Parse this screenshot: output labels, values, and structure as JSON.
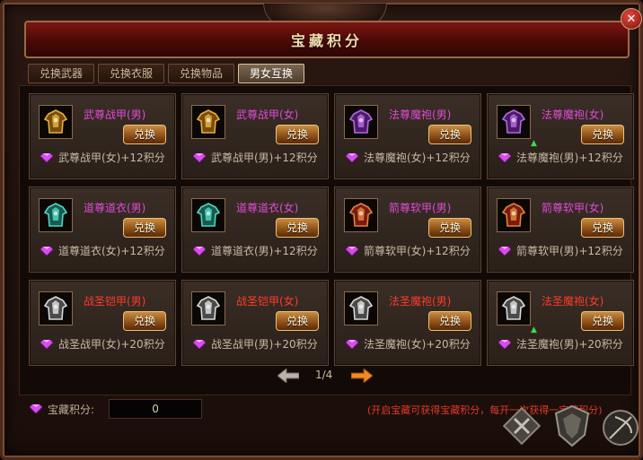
{
  "window": {
    "title": "宝藏积分",
    "close": "✕"
  },
  "tabs": [
    {
      "label": "兑换武器",
      "active": false
    },
    {
      "label": "兑换衣服",
      "active": false
    },
    {
      "label": "兑换物品",
      "active": false
    },
    {
      "label": "男女互换",
      "active": true
    }
  ],
  "cards": [
    {
      "name": "武尊战甲(男)",
      "cost": "武尊战甲(女)+12积分",
      "button": "兑换",
      "icon": "gold-armor-icon"
    },
    {
      "name": "武尊战甲(女)",
      "cost": "武尊战甲(男)+12积分",
      "button": "兑换",
      "icon": "gold-armor-icon"
    },
    {
      "name": "法尊魔袍(男)",
      "cost": "法尊魔袍(女)+12积分",
      "button": "兑换",
      "icon": "purple-robe-icon"
    },
    {
      "name": "法尊魔袍(女)",
      "cost": "法尊魔袍(男)+12积分",
      "button": "兑换",
      "icon": "purple-robe-icon"
    },
    {
      "name": "道尊道衣(男)",
      "cost": "道尊道衣(女)+12积分",
      "button": "兑换",
      "icon": "cyan-robe-icon"
    },
    {
      "name": "道尊道衣(女)",
      "cost": "道尊道衣(男)+12积分",
      "button": "兑换",
      "icon": "cyan-robe-icon"
    },
    {
      "name": "箭尊软甲(男)",
      "cost": "箭尊软甲(女)+12积分",
      "button": "兑换",
      "icon": "red-armor-icon"
    },
    {
      "name": "箭尊软甲(女)",
      "cost": "箭尊软甲(男)+12积分",
      "button": "兑换",
      "icon": "red-armor-icon"
    },
    {
      "name": "战圣铠甲(男)",
      "cost": "战圣战甲(女)+20积分",
      "button": "兑换",
      "icon": "silver-armor-icon"
    },
    {
      "name": "战圣铠甲(女)",
      "cost": "战圣战甲(男)+20积分",
      "button": "兑换",
      "icon": "silver-armor-icon"
    },
    {
      "name": "法圣魔袍(男)",
      "cost": "法圣魔袍(女)+20积分",
      "button": "兑换",
      "icon": "silver-armor-icon"
    },
    {
      "name": "法圣魔袍(女)",
      "cost": "法圣魔袍(男)+20积分",
      "button": "兑换",
      "icon": "silver-armor-icon"
    }
  ],
  "pager": {
    "text": "1/4"
  },
  "points": {
    "label": "宝藏积分:",
    "value": "0"
  },
  "info": "(开启宝藏可获得宝藏积分，每开一次获得一宝藏积分)",
  "colors": {
    "name_purple": "#e04ad6",
    "name_red": "#ff3a2a",
    "gem": "#d94cf0"
  }
}
